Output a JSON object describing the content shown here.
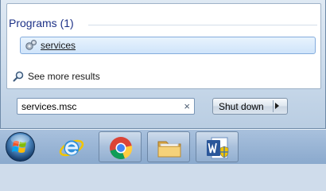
{
  "start_menu": {
    "group_title": "Programs (1)",
    "result": {
      "label": "services",
      "icon": "gears-icon"
    },
    "see_more_label": "See more results",
    "search": {
      "value": "services.msc",
      "clear_glyph": "×"
    },
    "shutdown_label": "Shut down"
  },
  "taskbar": {
    "start_icon": "windows-orb-icon",
    "apps": [
      {
        "name": "internet-explorer",
        "icon": "internet-explorer-icon"
      },
      {
        "name": "chrome",
        "icon": "chrome-icon"
      },
      {
        "name": "windows-explorer",
        "icon": "folder-icon"
      },
      {
        "name": "word",
        "icon": "word-icon"
      }
    ]
  },
  "colors": {
    "group_title": "#1e3287",
    "highlight": "#cfe4fa",
    "taskbar": "#9bb6d6"
  }
}
